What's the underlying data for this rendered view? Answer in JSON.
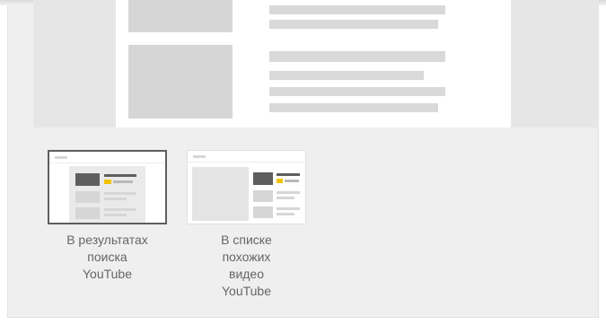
{
  "thumbnails": [
    {
      "id": "search",
      "label": "В результатах\nпоиска\nYouTube",
      "selected": true
    },
    {
      "id": "related",
      "label": "В списке\nпохожих\nвидео\nYouTube",
      "selected": false
    }
  ],
  "colors": {
    "accent": "#f2c200",
    "dark_block": "#5e5e5e",
    "placeholder": "#d6d6d6",
    "background": "#efefef"
  }
}
